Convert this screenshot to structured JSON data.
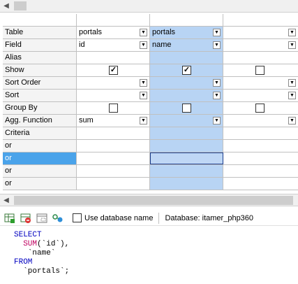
{
  "grid": {
    "rows": [
      {
        "label": "Table",
        "c1": "portals",
        "c2": "portals",
        "c3": ""
      },
      {
        "label": "Field",
        "c1": "id",
        "c2": "name",
        "c3": ""
      },
      {
        "label": "Alias",
        "c1": "",
        "c2": "",
        "c3": ""
      },
      {
        "label": "Show",
        "c1": "",
        "c2": "",
        "c3": ""
      },
      {
        "label": "Sort Order",
        "c1": "",
        "c2": "",
        "c3": ""
      },
      {
        "label": "Sort",
        "c1": "",
        "c2": "",
        "c3": ""
      },
      {
        "label": "Group By",
        "c1": "",
        "c2": "",
        "c3": ""
      },
      {
        "label": "Agg. Function",
        "c1": "sum",
        "c2": "",
        "c3": ""
      },
      {
        "label": "Criteria",
        "c1": "",
        "c2": "",
        "c3": ""
      },
      {
        "label": "or",
        "c1": "",
        "c2": "",
        "c3": ""
      },
      {
        "label": "or",
        "c1": "",
        "c2": "",
        "c3": ""
      },
      {
        "label": "or",
        "c1": "",
        "c2": "",
        "c3": ""
      },
      {
        "label": "or",
        "c1": "",
        "c2": "",
        "c3": ""
      }
    ],
    "show": {
      "c1": true,
      "c2": true,
      "c3": false
    },
    "group_by": {
      "c1": false,
      "c2": false,
      "c3": false
    }
  },
  "toolbar": {
    "use_db_name_label": "Use database name",
    "database_label": "Database: itamer_php360"
  },
  "sql": {
    "line1": "SELECT",
    "line2_fn": "SUM",
    "line2_rest": "(`id`),",
    "line3": "`name`",
    "line4": "FROM",
    "line5": "`portals`;"
  },
  "colors": {
    "selected_column": "#b8d4f4",
    "selected_row": "#4aa3ea",
    "keyword": "#0000c0",
    "function": "#c00060"
  },
  "icons": [
    "scroll-left-arrow-icon",
    "dropdown-arrow-icon",
    "add-table-icon",
    "remove-table-icon",
    "table-view-icon",
    "relation-icon"
  ]
}
